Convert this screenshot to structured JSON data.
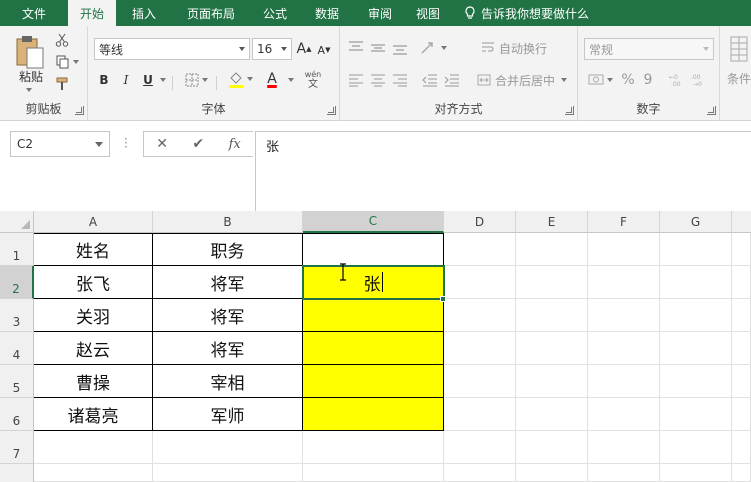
{
  "tabs": [
    {
      "label": "文件",
      "active": false
    },
    {
      "label": "开始",
      "active": true
    },
    {
      "label": "插入",
      "active": false
    },
    {
      "label": "页面布局",
      "active": false
    },
    {
      "label": "公式",
      "active": false
    },
    {
      "label": "数据",
      "active": false
    },
    {
      "label": "审阅",
      "active": false
    },
    {
      "label": "视图",
      "active": false
    }
  ],
  "tell_me": "告诉我你想要做什么",
  "ribbon": {
    "clipboard": {
      "paste_label": "粘贴",
      "group_label": "剪贴板"
    },
    "font": {
      "font_name": "等线",
      "font_size": "16",
      "bold": "B",
      "italic": "I",
      "underline": "U",
      "font_color_glyph": "A",
      "phonetic_glyph": "wén",
      "phonetic_sub": "文",
      "grow_glyph": "A",
      "shrink_glyph": "A",
      "group_label": "字体",
      "font_color": "#ff0000"
    },
    "alignment": {
      "wrap_text": "自动换行",
      "merge_center": "合并后居中",
      "group_label": "对齐方式"
    },
    "number": {
      "format": "常规",
      "percent": "%",
      "comma": "9",
      "group_label": "数字"
    },
    "styles": {
      "conditional_label": "条件"
    }
  },
  "formula_bar": {
    "name_box": "C2",
    "cancel": "✕",
    "enter": "✔",
    "fx": "fx",
    "value": "张"
  },
  "grid": {
    "columns": [
      "A",
      "B",
      "C",
      "D",
      "E",
      "F",
      "G"
    ],
    "selected_column": "C",
    "rows": [
      "1",
      "2",
      "3",
      "4",
      "5",
      "6",
      "7"
    ],
    "selected_row": "2",
    "cells": {
      "A1": "姓名",
      "B1": "职务",
      "A2": "张飞",
      "B2": "将军",
      "C2": "张",
      "A3": "关羽",
      "B3": "将军",
      "A4": "赵云",
      "B4": "将军",
      "A5": "曹操",
      "B5": "宰相",
      "A6": "诸葛亮",
      "B6": "军师"
    },
    "highlight_color": "#ffff00",
    "accent_color": "#217346"
  }
}
